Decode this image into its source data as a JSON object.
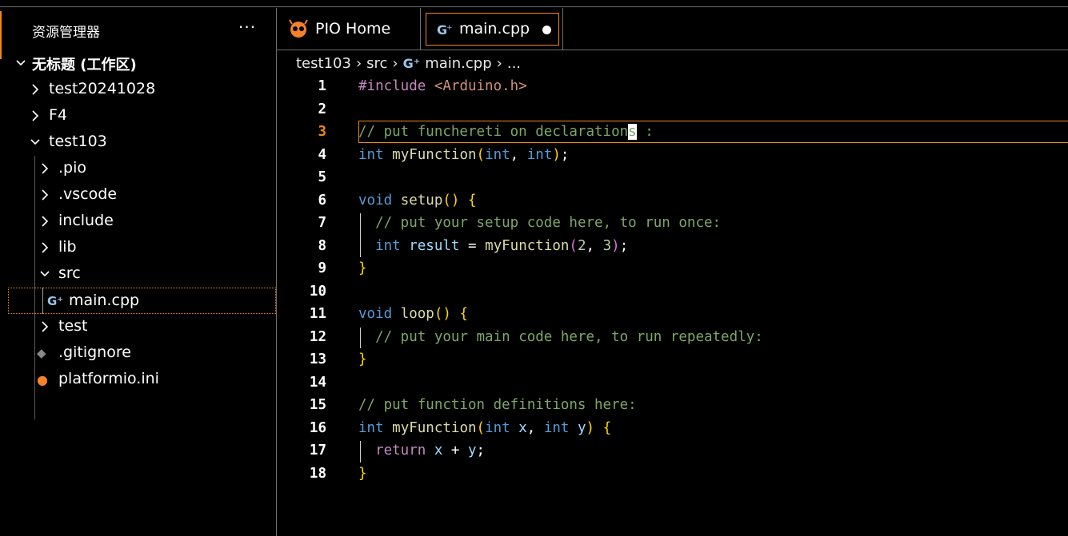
{
  "sidebar": {
    "title": "资源管理器",
    "more": "···",
    "workspace": "无标题 (工作区)",
    "items": [
      {
        "label": "test20241028",
        "chev": "right"
      },
      {
        "label": "F4",
        "chev": "right"
      },
      {
        "label": "test103",
        "chev": "down"
      },
      {
        "label": ".pio",
        "chev": "right"
      },
      {
        "label": ".vscode",
        "chev": "right"
      },
      {
        "label": "include",
        "chev": "right"
      },
      {
        "label": "lib",
        "chev": "right"
      },
      {
        "label": "src",
        "chev": "down"
      },
      {
        "label": "main.cpp",
        "icon": "cpp-file-icon"
      },
      {
        "label": "test",
        "chev": "right"
      },
      {
        "label": ".gitignore",
        "icon": "git-file-icon"
      },
      {
        "label": "platformio.ini",
        "icon": "platformio-file-icon"
      }
    ]
  },
  "tabs": [
    {
      "label": "PIO Home",
      "icon": "platformio-icon"
    },
    {
      "label": "main.cpp",
      "icon": "cpp-file-icon",
      "modified": true
    }
  ],
  "breadcrumb": [
    "test103",
    "src",
    "main.cpp",
    "..."
  ],
  "editor": {
    "current_line": 3,
    "lines": [
      [
        [
          "t-ctrl",
          "#include"
        ],
        [
          "t-def",
          " "
        ],
        [
          "t-str",
          "<Arduino.h>"
        ]
      ],
      [],
      [
        [
          "t-cm",
          "// put funchereti on declaration"
        ]
      ],
      [
        [
          "t-kw",
          "int"
        ],
        [
          "t-def",
          " "
        ],
        [
          "t-fn",
          "myFunction"
        ],
        [
          "t-br",
          "("
        ],
        [
          "t-kw",
          "int"
        ],
        [
          "t-def",
          ", "
        ],
        [
          "t-kw",
          "int"
        ],
        [
          "t-br",
          ")"
        ],
        [
          "t-def",
          ";"
        ]
      ],
      [],
      [
        [
          "t-kw",
          "void"
        ],
        [
          "t-def",
          " "
        ],
        [
          "t-fn",
          "setup"
        ],
        [
          "t-br",
          "()"
        ],
        [
          "t-def",
          " "
        ],
        [
          "t-br",
          "{"
        ]
      ],
      [
        [
          "t-def",
          "  "
        ],
        [
          "t-cm",
          "// put your setup code here, to run once:"
        ]
      ],
      [
        [
          "t-def",
          "  "
        ],
        [
          "t-kw",
          "int"
        ],
        [
          "t-def",
          " "
        ],
        [
          "t-var",
          "result"
        ],
        [
          "t-def",
          " = "
        ],
        [
          "t-fn",
          "myFunction"
        ],
        [
          "t-br2",
          "("
        ],
        [
          "t-num",
          "2"
        ],
        [
          "t-def",
          ", "
        ],
        [
          "t-num",
          "3"
        ],
        [
          "t-br2",
          ")"
        ],
        [
          "t-def",
          ";"
        ]
      ],
      [
        [
          "t-br",
          "}"
        ]
      ],
      [],
      [
        [
          "t-kw",
          "void"
        ],
        [
          "t-def",
          " "
        ],
        [
          "t-fn",
          "loop"
        ],
        [
          "t-br",
          "()"
        ],
        [
          "t-def",
          " "
        ],
        [
          "t-br",
          "{"
        ]
      ],
      [
        [
          "t-def",
          "  "
        ],
        [
          "t-cm",
          "// put your main code here, to run repeatedly:"
        ]
      ],
      [
        [
          "t-br",
          "}"
        ]
      ],
      [],
      [
        [
          "t-cm",
          "// put function definitions here:"
        ]
      ],
      [
        [
          "t-kw",
          "int"
        ],
        [
          "t-def",
          " "
        ],
        [
          "t-fn",
          "myFunction"
        ],
        [
          "t-br",
          "("
        ],
        [
          "t-kw",
          "int"
        ],
        [
          "t-def",
          " "
        ],
        [
          "t-var",
          "x"
        ],
        [
          "t-def",
          ", "
        ],
        [
          "t-kw",
          "int"
        ],
        [
          "t-def",
          " "
        ],
        [
          "t-var",
          "y"
        ],
        [
          "t-br",
          ")"
        ],
        [
          "t-def",
          " "
        ],
        [
          "t-br",
          "{"
        ]
      ],
      [
        [
          "t-def",
          "  "
        ],
        [
          "t-ctrl",
          "return"
        ],
        [
          "t-def",
          " "
        ],
        [
          "t-var",
          "x"
        ],
        [
          "t-def",
          " + "
        ],
        [
          "t-var",
          "y"
        ],
        [
          "t-def",
          ";"
        ]
      ],
      [
        [
          "t-br",
          "}"
        ]
      ]
    ],
    "line3": {
      "before": "// put funchereti on declaration",
      "cursor_char": "s",
      "after": " :"
    }
  },
  "colors": {
    "accent": "#f38518",
    "comment": "#7ca668",
    "keyword": "#569cd6"
  }
}
